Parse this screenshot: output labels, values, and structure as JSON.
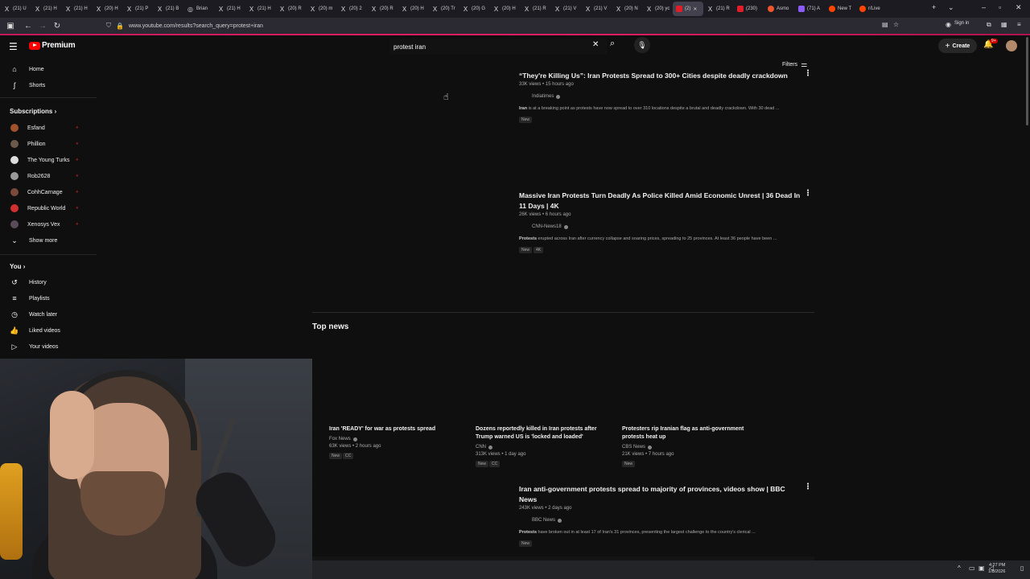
{
  "browser": {
    "tabs": [
      {
        "label": "(21) U",
        "icon": "X"
      },
      {
        "label": "(21) H",
        "icon": "X"
      },
      {
        "label": "(21) H",
        "icon": "X"
      },
      {
        "label": "(20) H",
        "icon": "X"
      },
      {
        "label": "(21) P",
        "icon": "X"
      },
      {
        "label": "(21) B",
        "icon": "X"
      },
      {
        "label": "Brian",
        "icon": "◎"
      },
      {
        "label": "(21) H",
        "icon": "X"
      },
      {
        "label": "(21) H",
        "icon": "X"
      },
      {
        "label": "(20) R",
        "icon": "X"
      },
      {
        "label": "(20) m",
        "icon": "X"
      },
      {
        "label": "(20) 2",
        "icon": "X"
      },
      {
        "label": "(20) R",
        "icon": "X"
      },
      {
        "label": "(20) H",
        "icon": "X"
      },
      {
        "label": "(20) Tr",
        "icon": "X"
      },
      {
        "label": "(20) G",
        "icon": "X"
      },
      {
        "label": "(20) H",
        "icon": "X"
      },
      {
        "label": "(21) R",
        "icon": "X"
      },
      {
        "label": "(21) V",
        "icon": "X"
      },
      {
        "label": "(21) V",
        "icon": "X"
      },
      {
        "label": "(20) N",
        "icon": "X"
      },
      {
        "label": "(20) yc",
        "icon": "X"
      },
      {
        "label": "(2)",
        "icon": "yt",
        "active": true
      },
      {
        "label": "(21) R",
        "icon": "X"
      },
      {
        "label": "(230)",
        "icon": "yt"
      },
      {
        "label": "Asmo",
        "icon": "o"
      },
      {
        "label": "(71) A",
        "icon": "p"
      },
      {
        "label": "New T",
        "icon": "rd"
      },
      {
        "label": "r/Live",
        "icon": "rd"
      }
    ],
    "url": "www.youtube.com/results?search_query=protest+iran",
    "sign_in": "Sign in"
  },
  "yt": {
    "logo_text": "Premium",
    "search_value": "protest iran",
    "create_label": "Create",
    "notif_badge": "9+",
    "filters_label": "Filters"
  },
  "sidebar": {
    "main": [
      {
        "label": "Home",
        "icon": "⌂"
      },
      {
        "label": "Shorts",
        "icon": "ʃ"
      }
    ],
    "subscriptions_heading": "Subscriptions",
    "subscriptions": [
      {
        "label": "Esfand",
        "color": "#a0522d"
      },
      {
        "label": "Phillion",
        "color": "#6b5a4a"
      },
      {
        "label": "The Young Turks",
        "color": "#dddddd"
      },
      {
        "label": "Rob2628",
        "color": "#999999"
      },
      {
        "label": "CohhCarnage",
        "color": "#7a4a3a"
      },
      {
        "label": "Republic World",
        "color": "#d32f2f"
      },
      {
        "label": "Xenosys Vex",
        "color": "#5a4a5a"
      }
    ],
    "show_more": "Show more",
    "you_heading": "You",
    "you_items": [
      {
        "label": "History",
        "icon": "↺"
      },
      {
        "label": "Playlists",
        "icon": "≡"
      },
      {
        "label": "Watch later",
        "icon": "◷"
      },
      {
        "label": "Liked videos",
        "icon": "👍"
      },
      {
        "label": "Your videos",
        "icon": "▷"
      }
    ]
  },
  "results": [
    {
      "title": "“They're Killing Us”: Iran Protests Spread to 300+ Cities despite deadly crackdown",
      "meta": "33K views • 15 hours ago",
      "channel": "Indiatimes",
      "desc_bold": "Iran",
      "desc": " is at a breaking point as protests have now spread to over 310 locations despite a brutal and deadly crackdown. With 30 dead ...",
      "badges": [
        "New"
      ]
    },
    {
      "title": "Massive Iran Protests Turn Deadly As Police Killed Amid Economic Unrest | 36 Dead In 11 Days | 4K",
      "meta": "26K views • 6 hours ago",
      "channel": "CNN-News18",
      "desc_bold": "Protests",
      "desc": " erupted across Iran after currency collapse and soaring prices, spreading to 25 provinces. At least 36 people have been ...",
      "badges": [
        "New",
        "4K"
      ]
    },
    {
      "title": "Iran anti-government protests spread to majority of provinces, videos show | BBC News",
      "meta": "243K views • 2 days ago",
      "channel": "BBC News",
      "desc_bold": "Protests",
      "desc": " have broken out in at least 17 of Iran's 31 provinces, presenting the largest challenge to the country's clerical ...",
      "badges": [
        "New"
      ]
    }
  ],
  "top_news": {
    "heading": "Top news",
    "items": [
      {
        "title": "Iran 'READY' for war as protests spread",
        "channel": "Fox News",
        "meta": "63K views • 2 hours ago",
        "badges": [
          "New",
          "CC"
        ]
      },
      {
        "title": "Dozens reportedly killed in Iran protests after Trump warned US is 'locked and loaded'",
        "channel": "CNN",
        "meta": "313K views • 1 day ago",
        "badges": [
          "New",
          "CC"
        ]
      },
      {
        "title": "Protesters rip Iranian flag as anti-government protests heat up",
        "channel": "CBS News",
        "meta": "21K views • 7 hours ago",
        "badges": [
          "New"
        ]
      }
    ]
  },
  "taskbar": {
    "time": "4:27 PM",
    "date": "1/8/2026"
  }
}
